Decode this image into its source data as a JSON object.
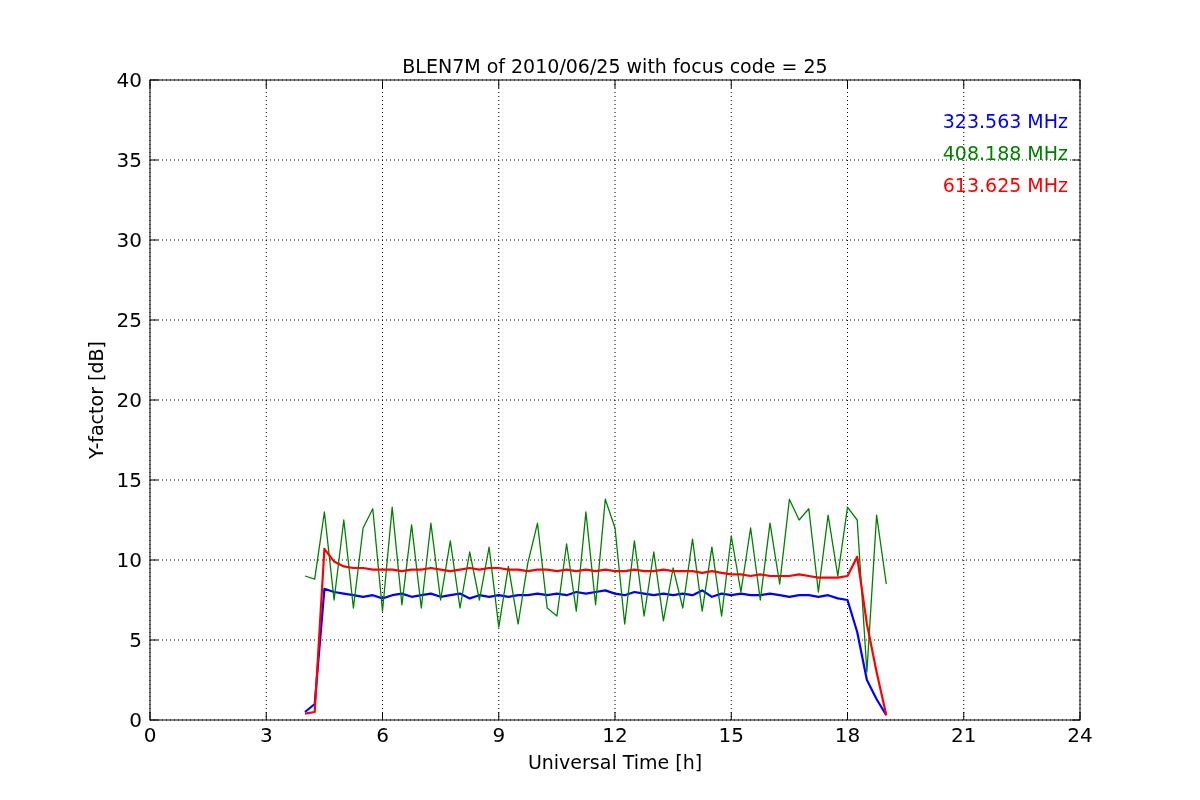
{
  "chart_data": {
    "type": "line",
    "title": "BLEN7M of 2010/06/25 with focus code = 25",
    "xlabel": "Universal Time [h]",
    "ylabel": "Y-factor [dB]",
    "x": [
      4,
      4.25,
      4.5,
      4.75,
      5,
      5.25,
      5.5,
      5.75,
      6,
      6.25,
      6.5,
      6.75,
      7,
      7.25,
      7.5,
      7.75,
      8,
      8.25,
      8.5,
      8.75,
      9,
      9.25,
      9.5,
      9.75,
      10,
      10.25,
      10.5,
      10.75,
      11,
      11.25,
      11.5,
      11.75,
      12,
      12.25,
      12.5,
      12.75,
      13,
      13.25,
      13.5,
      13.75,
      14,
      14.25,
      14.5,
      14.75,
      15,
      15.25,
      15.5,
      15.75,
      16,
      16.25,
      16.5,
      16.75,
      17,
      17.25,
      17.5,
      17.75,
      18,
      18.25,
      18.5,
      18.75,
      19
    ],
    "series": [
      {
        "name": "323.563 MHz",
        "color": "#0000ff",
        "values": [
          0.5,
          1.0,
          8.2,
          8.0,
          7.9,
          7.8,
          7.7,
          7.8,
          7.6,
          7.8,
          7.9,
          7.7,
          7.8,
          7.9,
          7.7,
          7.8,
          7.9,
          7.6,
          7.8,
          7.7,
          7.8,
          7.7,
          7.8,
          7.8,
          7.9,
          7.8,
          7.9,
          7.8,
          8.0,
          7.9,
          8.0,
          8.1,
          7.9,
          7.8,
          8.0,
          7.9,
          7.8,
          7.9,
          7.8,
          7.9,
          7.8,
          8.1,
          7.7,
          7.9,
          7.8,
          7.9,
          7.8,
          7.8,
          7.9,
          7.8,
          7.7,
          7.8,
          7.8,
          7.7,
          7.8,
          7.6,
          7.5,
          5.5,
          2.5,
          1.3,
          0.3
        ]
      },
      {
        "name": "408.188 MHz",
        "color": "#008000",
        "values": [
          9.0,
          8.8,
          13.0,
          7.5,
          12.5,
          7.0,
          12.0,
          13.2,
          6.8,
          13.3,
          7.2,
          12.2,
          7.0,
          12.3,
          7.5,
          11.2,
          7.0,
          10.5,
          7.5,
          10.8,
          5.8,
          9.6,
          6.0,
          9.8,
          12.3,
          7.0,
          6.5,
          11.0,
          6.8,
          13.0,
          7.2,
          13.8,
          12.0,
          6.0,
          11.2,
          6.5,
          10.5,
          6.2,
          9.5,
          7.0,
          11.3,
          6.8,
          10.8,
          6.5,
          11.5,
          8.0,
          12.0,
          7.5,
          12.3,
          8.5,
          13.8,
          12.5,
          13.2,
          8.0,
          12.8,
          9.0,
          13.3,
          12.5,
          3.0,
          12.8,
          8.5
        ]
      },
      {
        "name": "613.625 MHz",
        "color": "#ff0000",
        "values": [
          0.4,
          0.5,
          10.7,
          9.9,
          9.6,
          9.5,
          9.5,
          9.4,
          9.4,
          9.4,
          9.3,
          9.4,
          9.4,
          9.5,
          9.4,
          9.3,
          9.4,
          9.5,
          9.4,
          9.5,
          9.5,
          9.4,
          9.4,
          9.3,
          9.4,
          9.4,
          9.3,
          9.4,
          9.3,
          9.4,
          9.3,
          9.4,
          9.3,
          9.3,
          9.4,
          9.3,
          9.3,
          9.4,
          9.3,
          9.3,
          9.3,
          9.2,
          9.3,
          9.2,
          9.1,
          9.1,
          9.0,
          9.1,
          9.0,
          9.0,
          9.0,
          9.1,
          9.0,
          8.9,
          8.9,
          8.9,
          9.0,
          10.2,
          6.0,
          3.0,
          0.3
        ]
      }
    ],
    "xlim": [
      0,
      24
    ],
    "ylim": [
      0,
      40
    ],
    "xticks": [
      0,
      3,
      6,
      9,
      12,
      15,
      18,
      21,
      24
    ],
    "yticks": [
      0,
      5,
      10,
      15,
      20,
      25,
      30,
      35,
      40
    ],
    "grid": true
  }
}
